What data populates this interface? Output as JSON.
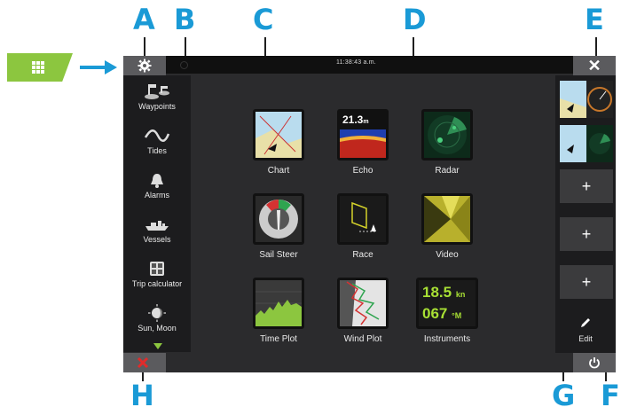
{
  "callouts": {
    "a": "A",
    "b": "B",
    "c": "C",
    "d": "D",
    "e": "E",
    "f": "F",
    "g": "G",
    "h": "H"
  },
  "topbar": {
    "time": "11:38:43 a.m."
  },
  "sidebar": {
    "items": [
      {
        "label": "Waypoints",
        "icon": "waypoints-icon"
      },
      {
        "label": "Tides",
        "icon": "tides-icon"
      },
      {
        "label": "Alarms",
        "icon": "bell-icon"
      },
      {
        "label": "Vessels",
        "icon": "vessels-icon"
      },
      {
        "label": "Trip calculator",
        "icon": "trip-calculator-icon"
      },
      {
        "label": "Sun, Moon",
        "icon": "sun-moon-icon"
      }
    ]
  },
  "apps": [
    {
      "label": "Chart"
    },
    {
      "label": "Echo",
      "value": "21.3",
      "unit": "m"
    },
    {
      "label": "Radar"
    },
    {
      "label": "Sail Steer"
    },
    {
      "label": "Race"
    },
    {
      "label": "Video"
    },
    {
      "label": "Time Plot"
    },
    {
      "label": "Wind Plot"
    },
    {
      "label": "Instruments",
      "speed": "18.5",
      "speed_unit": "kn",
      "heading": "067",
      "heading_unit": "°M"
    }
  ],
  "right_panel": {
    "plus": "+",
    "edit": "Edit"
  },
  "colors": {
    "accent": "#1a9ad6",
    "green": "#8cc63f"
  }
}
